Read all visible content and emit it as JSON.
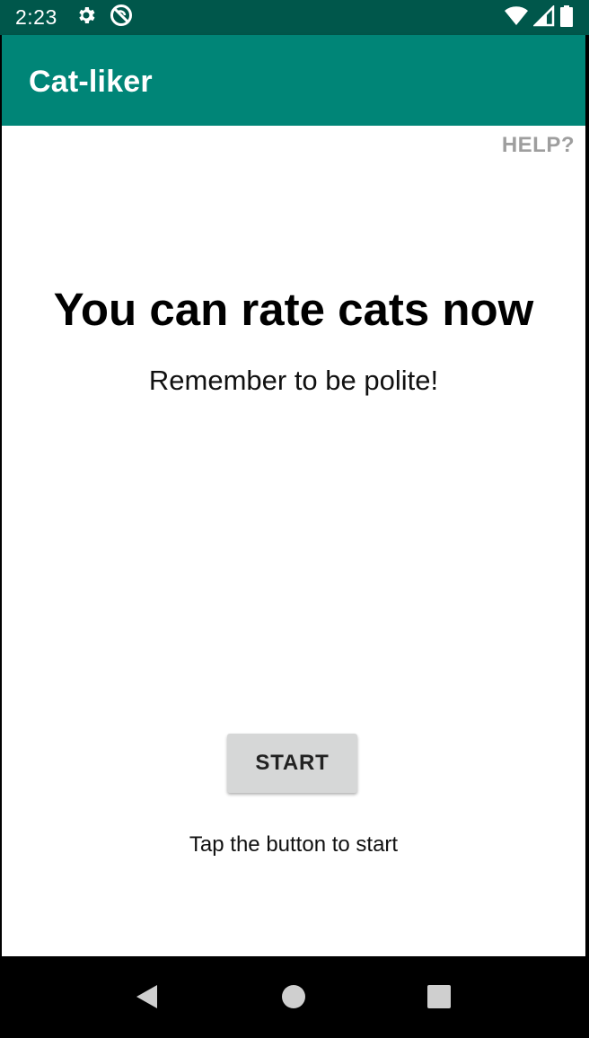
{
  "status_bar": {
    "time": "2:23",
    "icons": [
      "gear-icon",
      "no-sync-icon",
      "wifi-icon",
      "signal-icon",
      "battery-icon"
    ]
  },
  "app_bar": {
    "title": "Cat-liker"
  },
  "main": {
    "help_label": "HELP?",
    "headline": "You can rate cats now",
    "subline": "Remember to be polite!",
    "start_label": "START",
    "hint": "Tap the button to start"
  },
  "nav_bar": {
    "icons": [
      "back-icon",
      "home-icon",
      "recents-icon"
    ]
  },
  "colors": {
    "status_bar": "#00574b",
    "app_bar": "#008577",
    "button": "#d6d7d7",
    "help": "#9e9e9e"
  }
}
